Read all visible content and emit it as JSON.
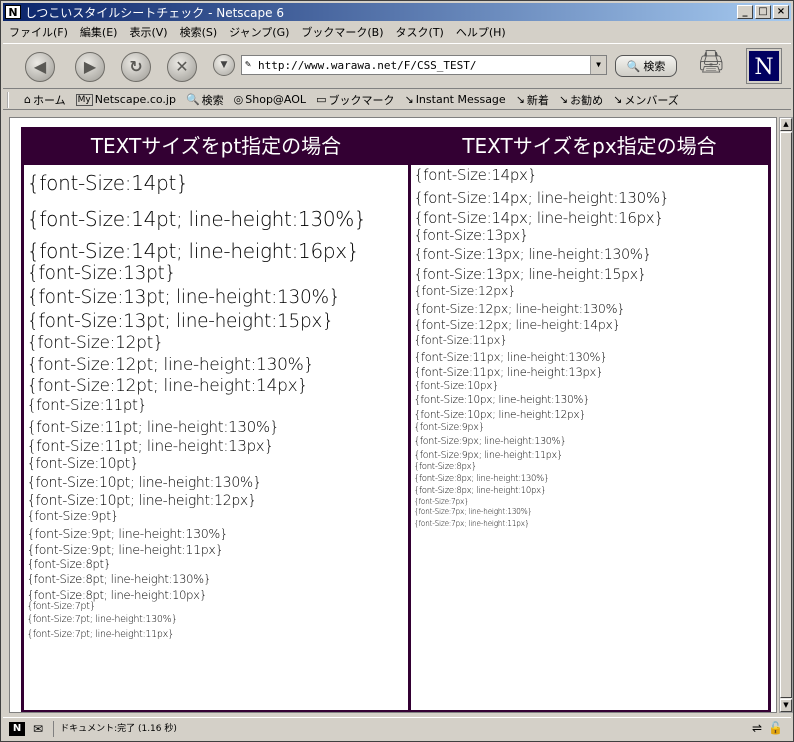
{
  "window": {
    "title": "しつこいスタイルシートチェック - Netscape 6",
    "app_icon": "N",
    "minimize": "_",
    "maximize": "□",
    "close": "×"
  },
  "menu": [
    "ファイル(F)",
    "編集(E)",
    "表示(V)",
    "検索(S)",
    "ジャンプ(G)",
    "ブックマーク(B)",
    "タスク(T)",
    "ヘルプ(H)"
  ],
  "nav": {
    "url": "http://www.warawa.net/F/CSS_TEST/",
    "search_label": "検索",
    "logo": "N"
  },
  "personal_toolbar": [
    {
      "icon": "home-icon",
      "glyph": "⌂",
      "label": "ホーム"
    },
    {
      "icon": "my-icon",
      "glyph": "My",
      "label": "Netscape.co.jp"
    },
    {
      "icon": "search-icon",
      "glyph": "🔍",
      "label": "検索"
    },
    {
      "icon": "aol-icon",
      "glyph": "◎",
      "label": "Shop@AOL"
    },
    {
      "icon": "folder-icon",
      "glyph": "▭",
      "label": "ブックマーク"
    },
    {
      "icon": "bookmark-icon",
      "glyph": "↘",
      "label": "Instant Message"
    },
    {
      "icon": "bookmark-icon",
      "glyph": "↘",
      "label": "新着"
    },
    {
      "icon": "bookmark-icon",
      "glyph": "↘",
      "label": "お勧め"
    },
    {
      "icon": "bookmark-icon",
      "glyph": "↘",
      "label": "メンバーズ"
    }
  ],
  "table": {
    "bg_color": "#330033",
    "headers": [
      "TEXTサイズをpt指定の場合",
      "TEXTサイズをpx指定の場合"
    ],
    "pt_items": [
      "{font-Size:14pt}",
      "{font-Size:14pt; line-height:130%}",
      "{font-Size:14pt; line-height:16px}",
      "{font-Size:13pt}",
      "{font-Size:13pt; line-height:130%}",
      "{font-Size:13pt; line-height:15px}",
      "{font-Size:12pt}",
      "{font-Size:12pt; line-height:130%}",
      "{font-Size:12pt; line-height:14px}",
      "{font-Size:11pt}",
      "{font-Size:11pt; line-height:130%}",
      "{font-Size:11pt; line-height:13px}",
      "{font-Size:10pt}",
      "{font-Size:10pt; line-height:130%}",
      "{font-Size:10pt; line-height:12px}",
      "{font-Size:9pt}",
      "{font-Size:9pt; line-height:130%}",
      "{font-Size:9pt; line-height:11px}",
      "{font-Size:8pt}",
      "{font-Size:8pt; line-height:130%}",
      "{font-Size:8pt; line-height:10px}",
      "{font-Size:7pt}",
      "{font-Size:7pt; line-height:130%}",
      "{font-Size:7pt; line-height:11px}"
    ],
    "px_items": [
      "{font-Size:14px}",
      "{font-Size:14px; line-height:130%}",
      "{font-Size:14px; line-height:16px}",
      "{font-Size:13px}",
      "{font-Size:13px; line-height:130%}",
      "{font-Size:13px; line-height:15px}",
      "{font-Size:12px}",
      "{font-Size:12px; line-height:130%}",
      "{font-Size:12px; line-height:14px}",
      "{font-Size:11px}",
      "{font-Size:11px; line-height:130%}",
      "{font-Size:11px; line-height:13px}",
      "{font-Size:10px}",
      "{font-Size:10px; line-height:130%}",
      "{font-Size:10px; line-height:12px}",
      "{font-Size:9px}",
      "{font-Size:9px; line-height:130%}",
      "{font-Size:9px; line-height:11px}",
      "{font-Size:8px}",
      "{font-Size:8px; line-height:130%}",
      "{font-Size:8px; line-height:10px}",
      "{font-Size:7px}",
      "{font-Size:7px; line-height:130%}",
      "{font-Size:7px; line-height:11px}"
    ]
  },
  "status": {
    "text": "ドキュメント:完了 (1.16 秒)"
  }
}
